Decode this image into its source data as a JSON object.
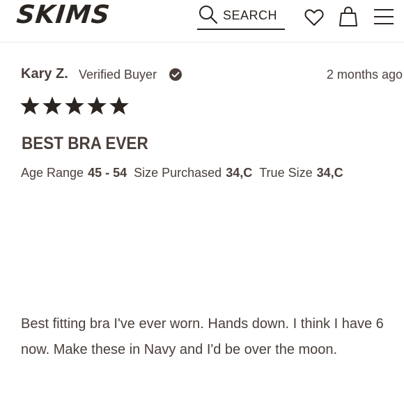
{
  "header": {
    "logo": "SKIMS",
    "search_label": "SEARCH"
  },
  "review": {
    "reviewer": "Kary Z.",
    "verified_label": "Verified Buyer",
    "date": "2 months ago",
    "rating": 5,
    "title": "BEST BRA EVER",
    "attributes": [
      {
        "label": "Age Range",
        "value": "45 - 54"
      },
      {
        "label": "Size Purchased",
        "value": "34,C"
      },
      {
        "label": "True Size",
        "value": "34,C"
      }
    ],
    "body": "Best fitting bra I've ever worn. Hands down. I think I have 6 now. Make these in Navy and I'd be over the moon."
  },
  "colors": {
    "text": "#4a3f3a",
    "star": "#2b2521",
    "background": "#ffffff"
  },
  "icons": [
    "search-icon",
    "heart-icon",
    "bag-icon",
    "menu-icon",
    "verified-check-icon",
    "star-icon"
  ]
}
